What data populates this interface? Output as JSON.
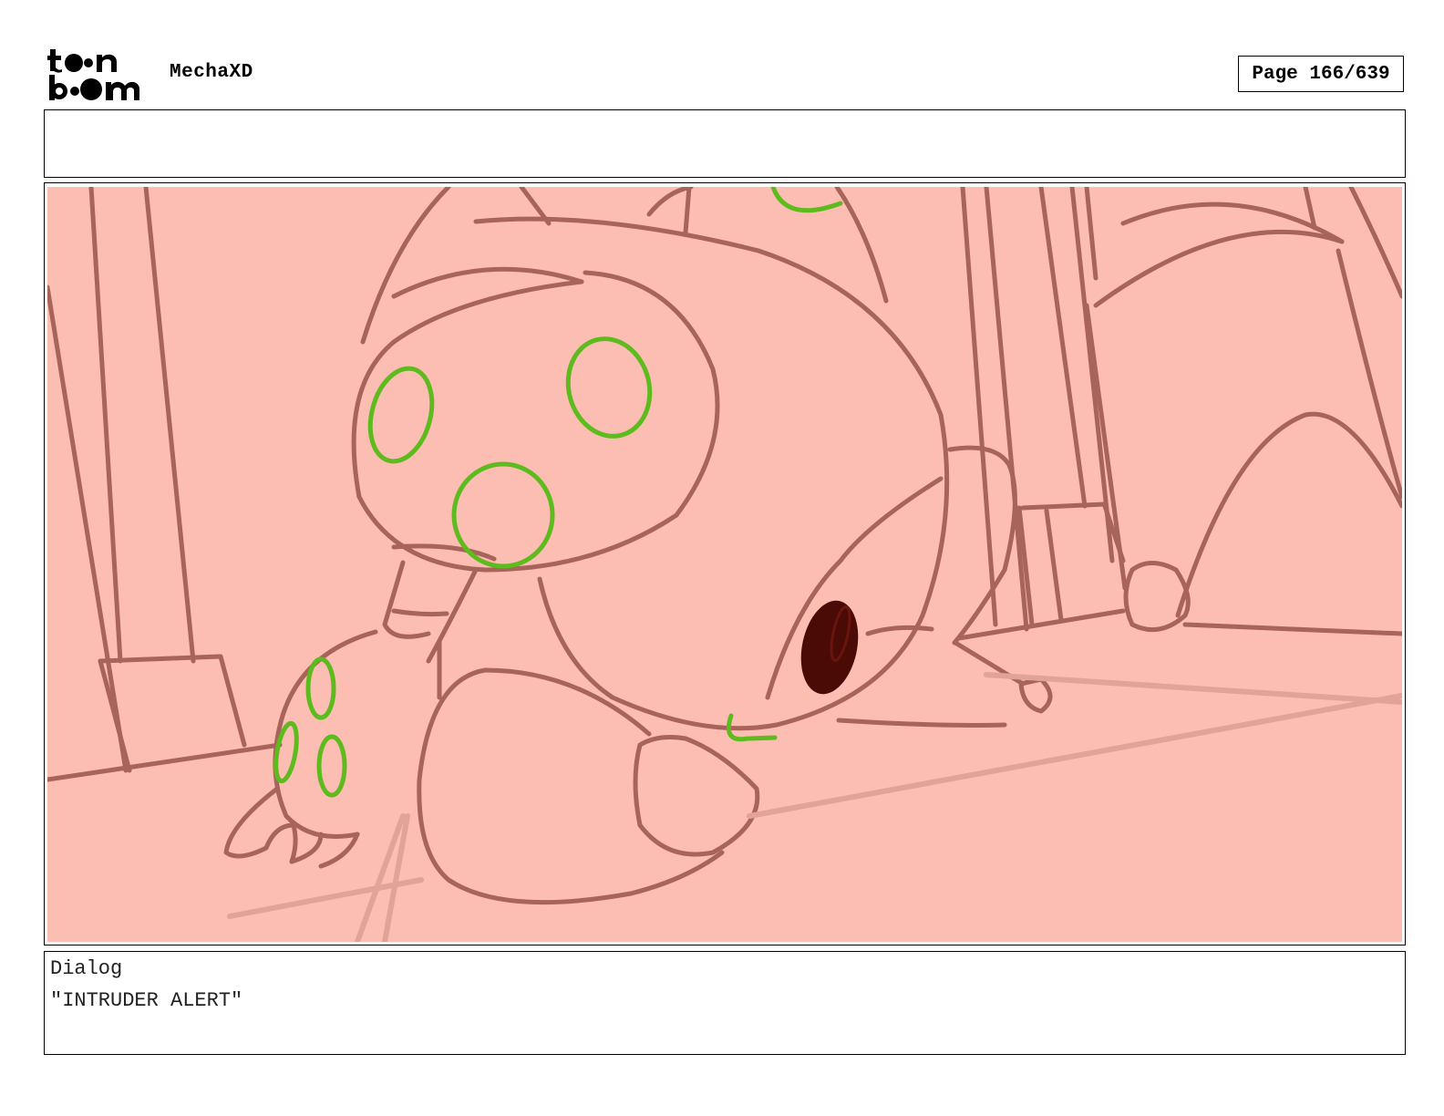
{
  "header": {
    "logo_text": "toon boom",
    "project_title": "MechaXD",
    "page_label": "Page 166/639"
  },
  "frame": {
    "background_color": "#fcbdb3",
    "line_color": "#a8635a",
    "accent_color": "#5dbb1e",
    "dark_color": "#4a0a06"
  },
  "dialog": {
    "label": "Dialog",
    "text": "\"INTRUDER ALERT\""
  }
}
